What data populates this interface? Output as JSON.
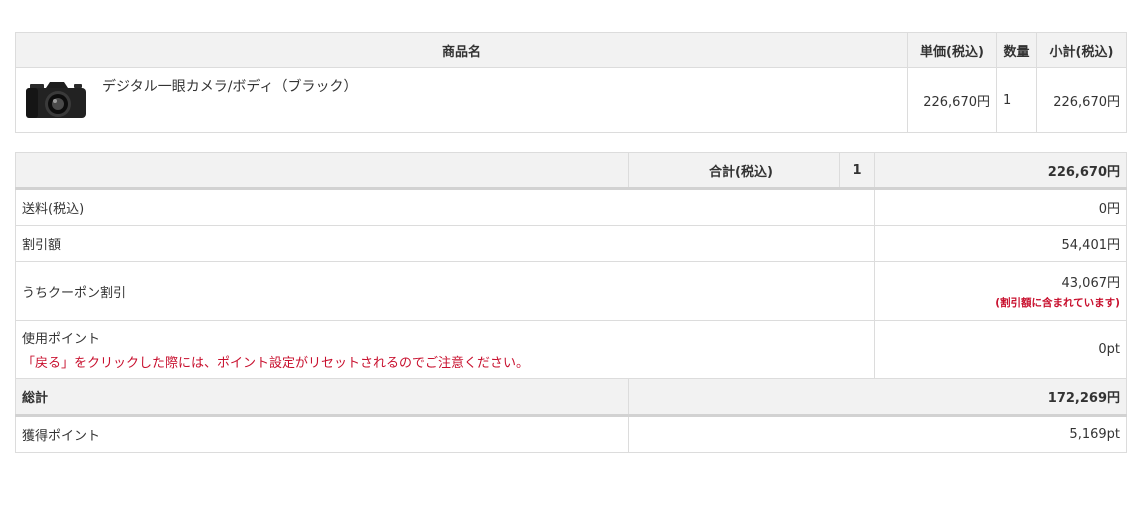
{
  "product_table": {
    "headers": {
      "name": "商品名",
      "unit_price": "単価(税込)",
      "qty": "数量",
      "subtotal": "小計(税込)"
    },
    "items": [
      {
        "name": "デジタル一眼カメラ/ボディ（ブラック）",
        "unit_price": "226,670円",
        "qty": "1",
        "subtotal": "226,670円",
        "image_icon": "camera-icon"
      }
    ]
  },
  "summary": {
    "total_label": "合計(税込)",
    "total_qty": "1",
    "total_value": "226,670円",
    "rows": {
      "shipping": {
        "label": "送料(税込)",
        "value": "0円"
      },
      "discount": {
        "label": "割引額",
        "value": "54,401円"
      },
      "coupon": {
        "label": "うちクーポン割引",
        "value": "43,067円",
        "note": "(割引額に含まれています)"
      },
      "points": {
        "label": "使用ポイント",
        "warning": "「戻る」をクリックした際には、ポイント設定がリセットされるのでご注意ください。",
        "value": "0pt"
      },
      "grand_total": {
        "label": "総計",
        "value": "172,269円"
      },
      "earned": {
        "label": "獲得ポイント",
        "value": "5,169pt"
      }
    }
  },
  "colors": {
    "header_bg": "#f2f2f2",
    "border": "#dcdcdc",
    "warning_red": "#c8102e"
  }
}
